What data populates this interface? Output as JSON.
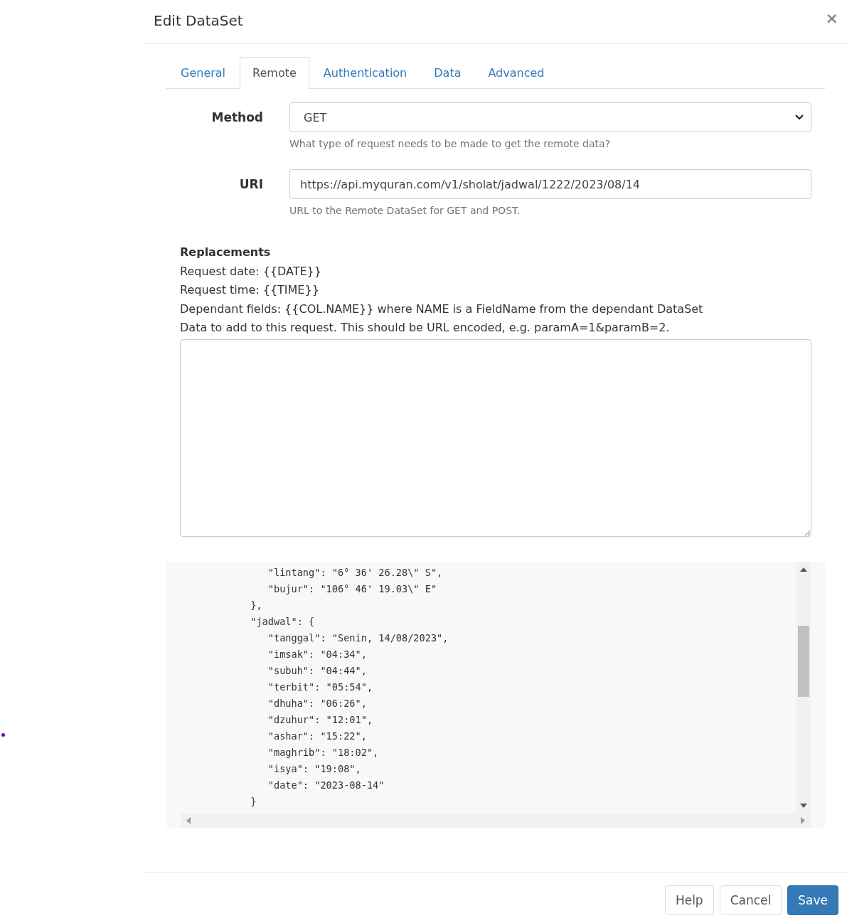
{
  "dialog": {
    "title": "Edit DataSet",
    "close": "×"
  },
  "tabs": [
    {
      "label": "General",
      "selected": false
    },
    {
      "label": "Remote",
      "selected": true
    },
    {
      "label": "Authentication",
      "selected": false
    },
    {
      "label": "Data",
      "selected": false
    },
    {
      "label": "Advanced",
      "selected": false
    }
  ],
  "fields": [
    {
      "kind": "select",
      "label": "Method",
      "value": "GET",
      "help": "What type of request needs to be made to get the remote data?"
    },
    {
      "kind": "text",
      "label": "URI",
      "value": "https://api.myquran.com/v1/sholat/jadwal/1222/2023/08/14",
      "help": "URL to the Remote DataSet for GET and POST."
    }
  ],
  "replacements": {
    "heading": "Replacements",
    "lines": [
      "Request date: {{DATE}}",
      "Request time: {{TIME}}",
      "Dependant fields: {{COL.NAME}} where NAME is a FieldName from the dependant DataSet",
      "Data to add to this request. This should be URL encoded, e.g. paramA=1&paramB=2."
    ]
  },
  "code_lines": [
    "               \"lintang\": \"6° 36' 26.28\\\" S\",",
    "               \"bujur\": \"106° 46' 19.03\\\" E\"",
    "            },",
    "            \"jadwal\": {",
    "               \"tanggal\": \"Senin, 14/08/2023\",",
    "               \"imsak\": \"04:34\",",
    "               \"subuh\": \"04:44\",",
    "               \"terbit\": \"05:54\",",
    "               \"dhuha\": \"06:26\",",
    "               \"dzuhur\": \"12:01\",",
    "               \"ashar\": \"15:22\",",
    "               \"maghrib\": \"18:02\",",
    "               \"isya\": \"19:08\",",
    "               \"date\": \"2023-08-14\"",
    "            }"
  ],
  "buttons": [
    {
      "kind": "default",
      "label": "Help"
    },
    {
      "kind": "default",
      "label": "Cancel"
    },
    {
      "kind": "primary",
      "label": "Save"
    }
  ]
}
